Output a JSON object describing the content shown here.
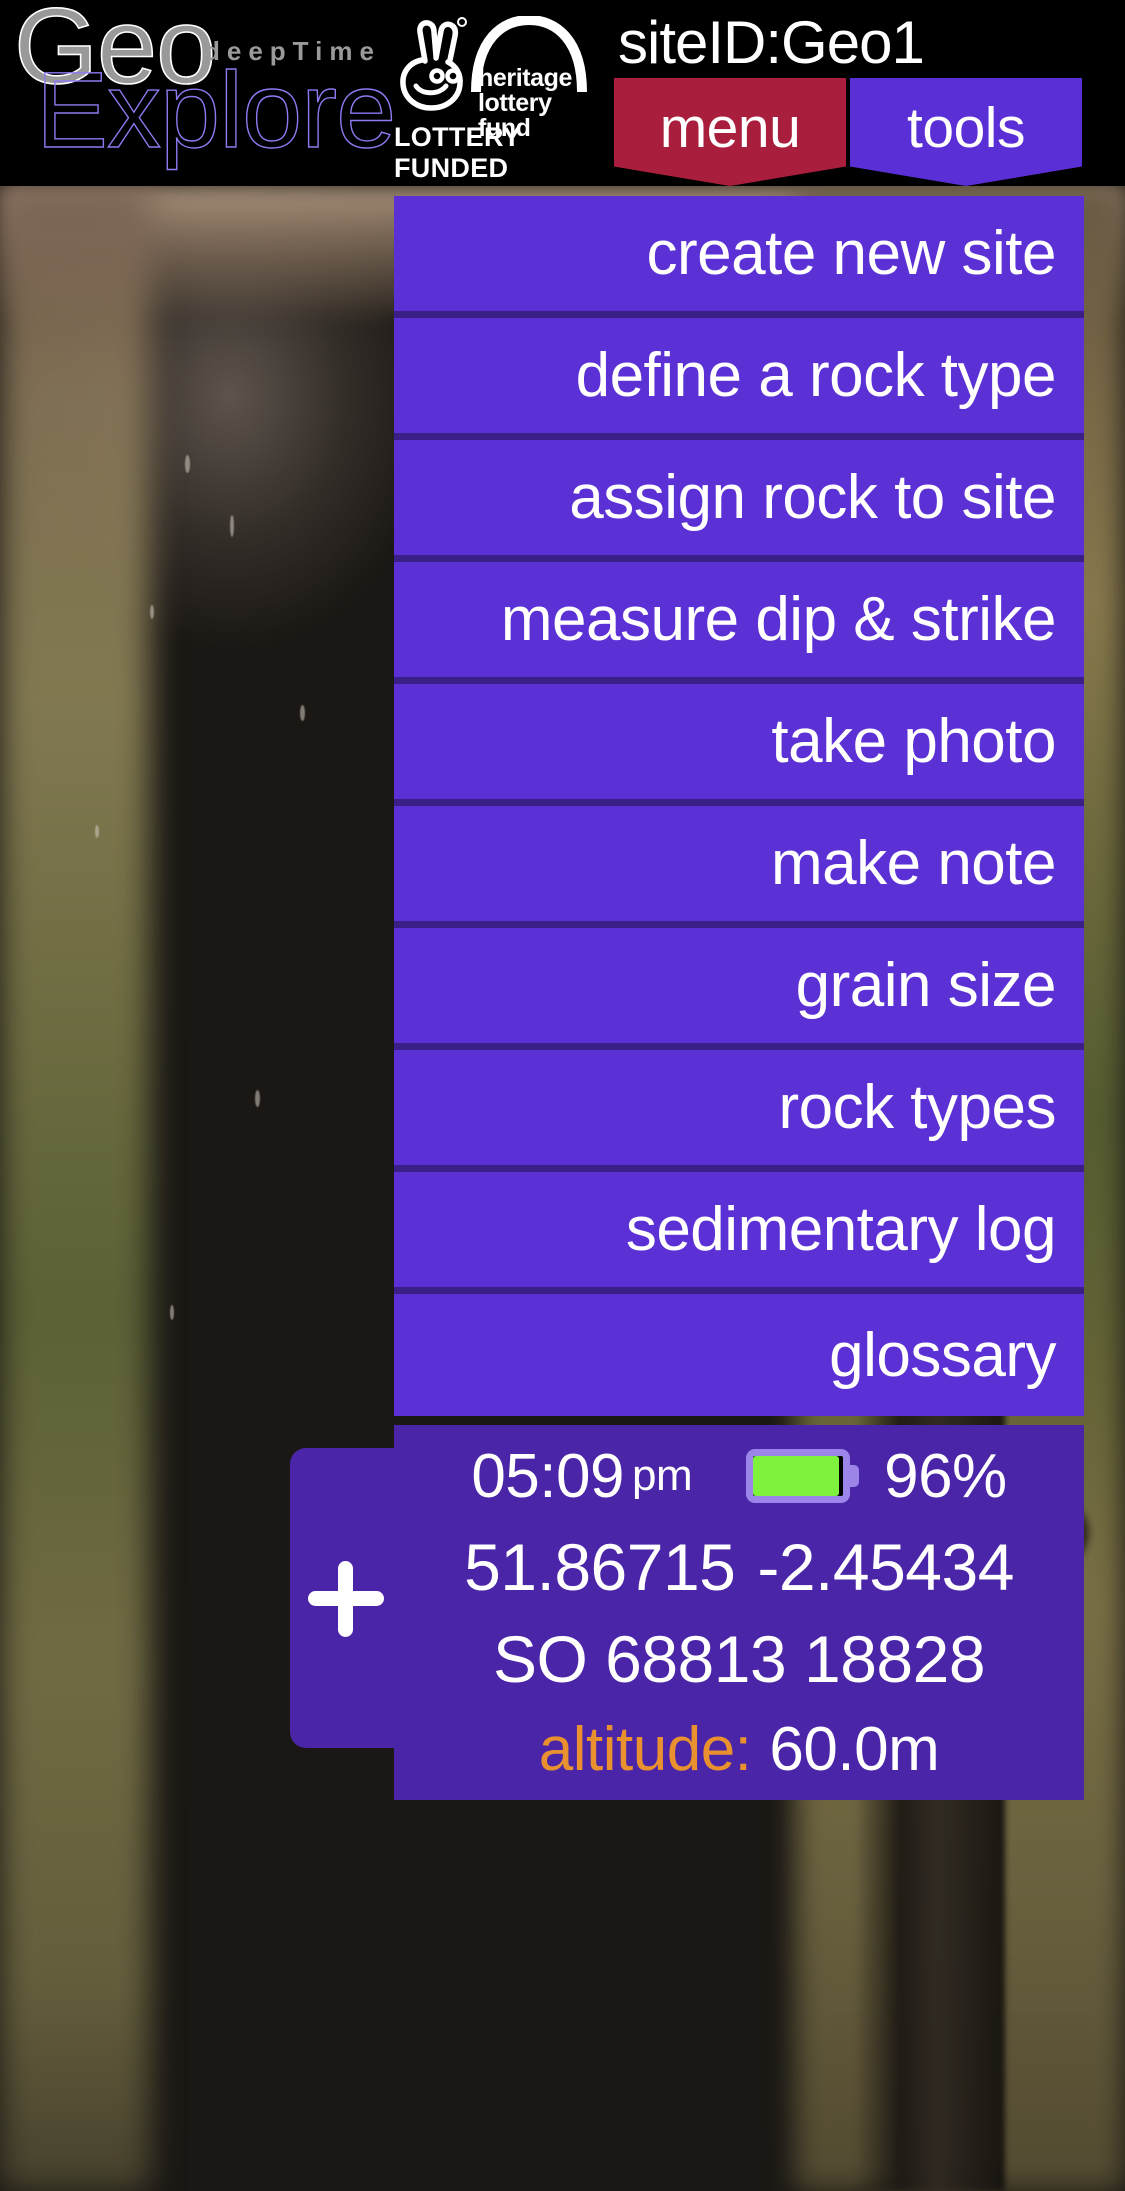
{
  "header": {
    "logo": {
      "line1": "Geo",
      "line2": "Explore",
      "tagline": "deepTime"
    },
    "funder": {
      "name_line1": "heritage",
      "name_line2": "lottery fund",
      "funded_label": "LOTTERY FUNDED",
      "fingers_icon": "crossed-fingers-icon",
      "arch_icon": "arch-icon"
    },
    "site_id": "siteID:Geo1",
    "tabs": [
      {
        "label": "menu",
        "active": true,
        "color": "#a91e3c"
      },
      {
        "label": "tools",
        "active": false,
        "color": "#5b2fd6"
      }
    ]
  },
  "menu": {
    "items": [
      {
        "label": "create new site"
      },
      {
        "label": "define a rock type"
      },
      {
        "label": "assign rock to site"
      },
      {
        "label": "measure dip & strike"
      },
      {
        "label": "take photo"
      },
      {
        "label": "make note"
      },
      {
        "label": "grain size"
      },
      {
        "label": "rock types"
      },
      {
        "label": "sedimentary log"
      },
      {
        "label": "glossary"
      }
    ]
  },
  "status": {
    "time": "05:09",
    "ampm": "pm",
    "battery_percent": "96%",
    "battery_level": 96,
    "latitude": "51.86715",
    "longitude": "-2.45434",
    "grid_reference": "SO 68813 18828",
    "altitude_label": "altitude:",
    "altitude_value": "60.0m"
  },
  "controls": {
    "add_button_label": "+"
  },
  "colors": {
    "menu_item": "#5b30d4",
    "panel": "#4a25a8",
    "divider": "#3a1f86",
    "tab_active": "#a91e3c",
    "tab_inactive": "#5b2fd6",
    "battery_fill": "#7ef23c",
    "altitude_accent": "#e8912e",
    "logo_explore": "#8a7bf0"
  }
}
